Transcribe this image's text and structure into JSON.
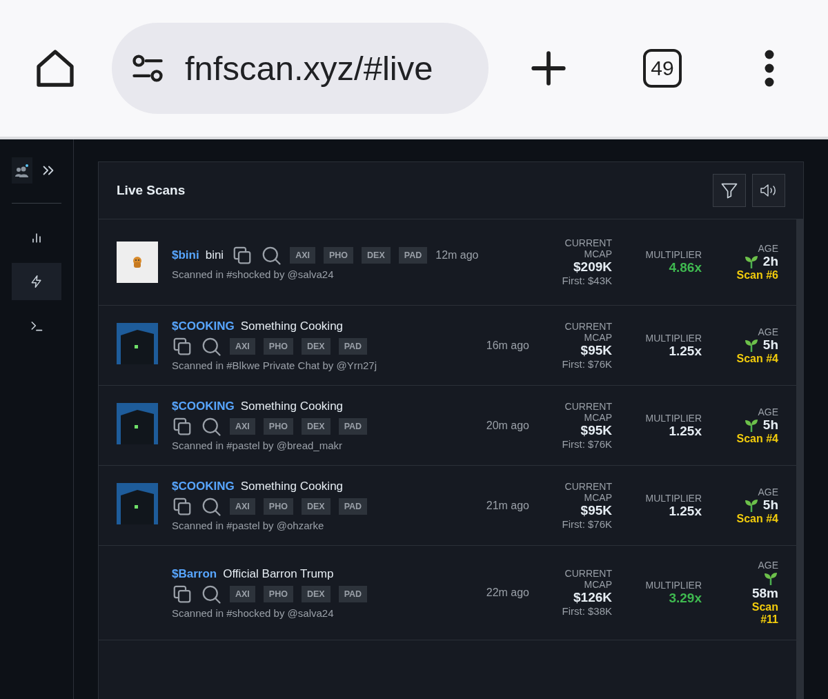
{
  "browser": {
    "url": "fnfscan.xyz/#live",
    "tab_count": "49"
  },
  "sidebar": {
    "items": [
      {
        "kind": "chart",
        "selected": false
      },
      {
        "kind": "bolt",
        "selected": true
      },
      {
        "kind": "terminal",
        "selected": false
      }
    ]
  },
  "panel": {
    "title": "Live Scans"
  },
  "scans": [
    {
      "kind": "inline",
      "ticker": "$bini",
      "name": "bini",
      "tags": [
        "AXI",
        "PHO",
        "DEX",
        "PAD"
      ],
      "time": "12m ago",
      "source": "Scanned in #shocked by @salva24",
      "mcap_label": "CURRENT MCAP",
      "mcap": "$209K",
      "first": "First: $43K",
      "multiplier_label": "MULTIPLIER",
      "multiplier": "4.86x",
      "gain": true,
      "age_label": "AGE",
      "age": "2h",
      "scan": "Scan #6"
    },
    {
      "kind": "stacked",
      "ticker": "$COOKING",
      "name": "Something Cooking",
      "tags": [
        "AXI",
        "PHO",
        "DEX",
        "PAD"
      ],
      "time": "16m ago",
      "source": "Scanned in #Blkwe Private Chat by @Yrn27j",
      "mcap_label": "CURRENT MCAP",
      "mcap": "$95K",
      "first": "First: $76K",
      "multiplier_label": "MULTIPLIER",
      "multiplier": "1.25x",
      "gain": false,
      "age_label": "AGE",
      "age": "5h",
      "scan": "Scan #4"
    },
    {
      "kind": "stacked",
      "ticker": "$COOKING",
      "name": "Something Cooking",
      "tags": [
        "AXI",
        "PHO",
        "DEX",
        "PAD"
      ],
      "time": "20m ago",
      "source": "Scanned in #pastel by @bread_makr",
      "mcap_label": "CURRENT MCAP",
      "mcap": "$95K",
      "first": "First: $76K",
      "multiplier_label": "MULTIPLIER",
      "multiplier": "1.25x",
      "gain": false,
      "age_label": "AGE",
      "age": "5h",
      "scan": "Scan #4"
    },
    {
      "kind": "stacked",
      "ticker": "$COOKING",
      "name": "Something Cooking",
      "tags": [
        "AXI",
        "PHO",
        "DEX",
        "PAD"
      ],
      "time": "21m ago",
      "source": "Scanned in #pastel by @ohzarke",
      "mcap_label": "CURRENT MCAP",
      "mcap": "$95K",
      "first": "First: $76K",
      "multiplier_label": "MULTIPLIER",
      "multiplier": "1.25x",
      "gain": false,
      "age_label": "AGE",
      "age": "5h",
      "scan": "Scan #4"
    },
    {
      "kind": "stacked",
      "ticker": "$Barron",
      "name": "Official Barron Trump",
      "tags": [
        "AXI",
        "PHO",
        "DEX",
        "PAD"
      ],
      "time": "22m ago",
      "source": "Scanned in #shocked by @salva24",
      "mcap_label": "CURRENT MCAP",
      "mcap": "$126K",
      "first": "First: $38K",
      "multiplier_label": "MULTIPLIER",
      "multiplier": "3.29x",
      "gain": true,
      "age_label": "AGE",
      "age": "58m",
      "scan": "Scan #11"
    }
  ]
}
